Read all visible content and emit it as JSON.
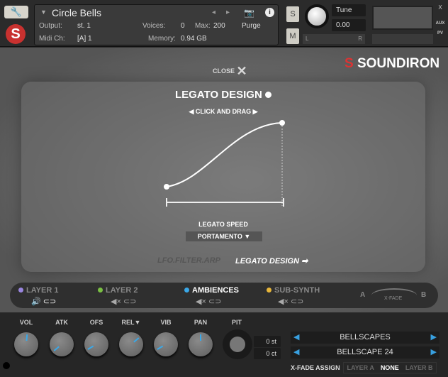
{
  "header": {
    "instrument_name": "Circle Bells",
    "output_label": "Output:",
    "output_value": "st. 1",
    "voices_label": "Voices:",
    "voices_value": "0",
    "max_label": "Max:",
    "max_value": "200",
    "purge_label": "Purge",
    "midi_label": "Midi Ch:",
    "midi_value": "[A] 1",
    "memory_label": "Memory:",
    "memory_value": "0.94 GB",
    "solo": "S",
    "mute": "M",
    "tune_label": "Tune",
    "tune_value": "0.00",
    "pan_l": "L",
    "pan_r": "R",
    "aux": "AUX",
    "pv": "PV",
    "close_x": "X",
    "minimize": "-"
  },
  "main": {
    "close_label": "CLOSE",
    "brand": "SOUNDIRON",
    "panel_title": "LEGATO DESIGN",
    "instruction": "CLICK AND DRAG",
    "speed_label": "LEGATO SPEED",
    "speed_value": "PORTAMENTO",
    "tab_lfo": "LFO.FILTER.ARP",
    "tab_legato": "LEGATO DESIGN"
  },
  "layers": [
    {
      "name": "LAYER 1",
      "color": "#9a86e0"
    },
    {
      "name": "LAYER 2",
      "color": "#7ac043"
    },
    {
      "name": "AMBIENCES",
      "color": "#3aa8e8"
    },
    {
      "name": "SUB-SYNTH",
      "color": "#e8b63a"
    }
  ],
  "xfade": {
    "a": "A",
    "b": "B",
    "label": "X-FADE"
  },
  "knobs": [
    {
      "label": "VOL",
      "angle": 5
    },
    {
      "label": "ATK",
      "angle": -130
    },
    {
      "label": "OFS",
      "angle": -120
    },
    {
      "label": "REL",
      "angle": 50
    },
    {
      "label": "VIB",
      "angle": -120
    },
    {
      "label": "PAN",
      "angle": 0
    }
  ],
  "pitch": {
    "label": "PIT",
    "st": "0 st",
    "ct": "0 ct"
  },
  "presets": {
    "category": "BELLSCAPES",
    "preset": "BELLSCAPE 24"
  },
  "xfade_assign": {
    "label": "X-FADE ASSIGN",
    "options": [
      "LAYER A",
      "NONE",
      "LAYER B"
    ],
    "selected": "NONE"
  }
}
